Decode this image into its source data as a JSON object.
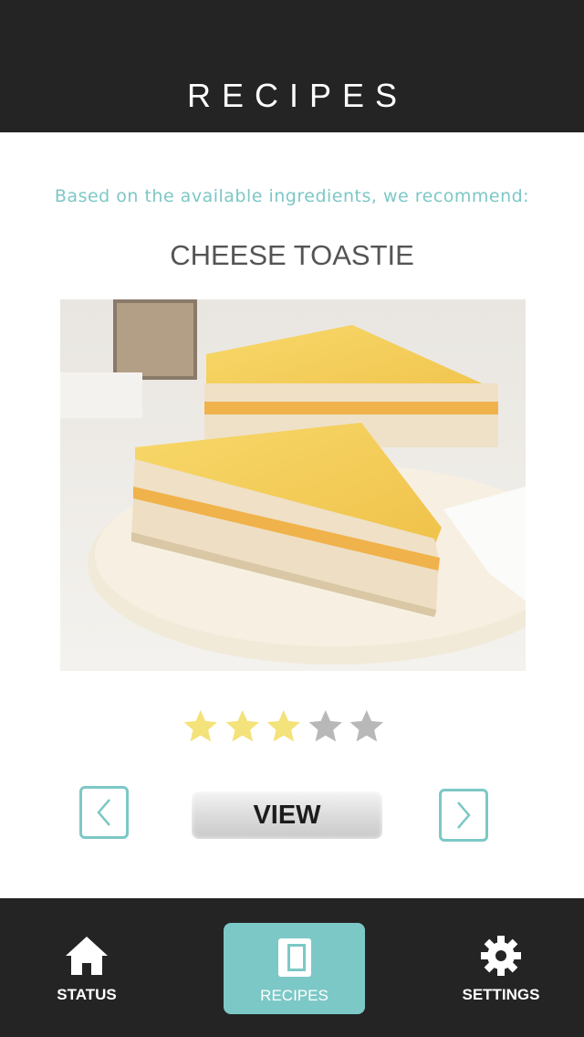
{
  "header": {
    "title": "RECIPES"
  },
  "main": {
    "subtitle": "Based on the available ingredients, we recommend:",
    "recipe_name": "CHEESE TOASTIE",
    "rating": {
      "value": 3,
      "max": 5
    },
    "view_label": "VIEW"
  },
  "tabs": {
    "status": {
      "label": "STATUS",
      "icon": "home-icon"
    },
    "recipes": {
      "label": "RECIPES",
      "icon": "book-icon"
    },
    "settings": {
      "label": "SETTINGS",
      "icon": "gear-icon"
    }
  },
  "colors": {
    "accent": "#7cc8c6",
    "dark": "#242424",
    "star_filled": "#f4e27a",
    "star_empty": "#b8b8b8"
  }
}
